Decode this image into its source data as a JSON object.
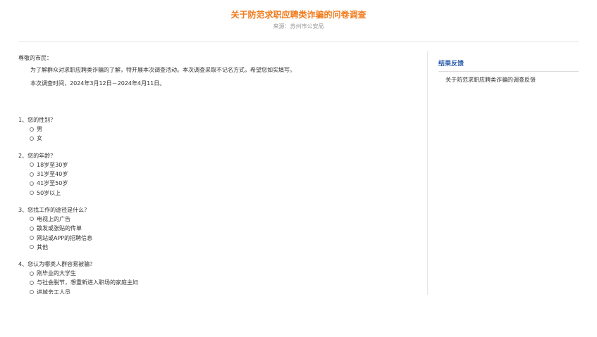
{
  "header": {
    "title": "关于防范求职应聘类诈骗的问卷调查",
    "source": "来源：苏州市公安局"
  },
  "intro": {
    "greeting": "尊敬的市民：",
    "paragraphs": [
      "为了解群众对求职应聘类诈骗的了解，特开展本次调查活动。本次调查采取不记名方式，希望您如实填写。",
      "本次调查时间，2024年3月12日－2024年4月11日。"
    ]
  },
  "questions": [
    {
      "title": "1、您的性别？",
      "options": [
        "男",
        "女"
      ]
    },
    {
      "title": "2、您的年龄？",
      "options": [
        "18岁至30岁",
        "31岁至40岁",
        "41岁至50岁",
        "50岁以上"
      ]
    },
    {
      "title": "3、您找工作的途径是什么？",
      "options": [
        "电视上的广告",
        "散发或张贴的传单",
        "网站或APP的招聘信息",
        "其他"
      ]
    },
    {
      "title": "4、您认为哪类人群容易被骗？",
      "options": [
        "刚毕业的大学生",
        "与社会脱节，想重新进入职场的家庭主妇",
        "进城务工人员"
      ]
    }
  ],
  "sidebar": {
    "title": "结果反馈",
    "links": [
      "关于防范求职应聘类诈骗的调查反馈"
    ]
  }
}
